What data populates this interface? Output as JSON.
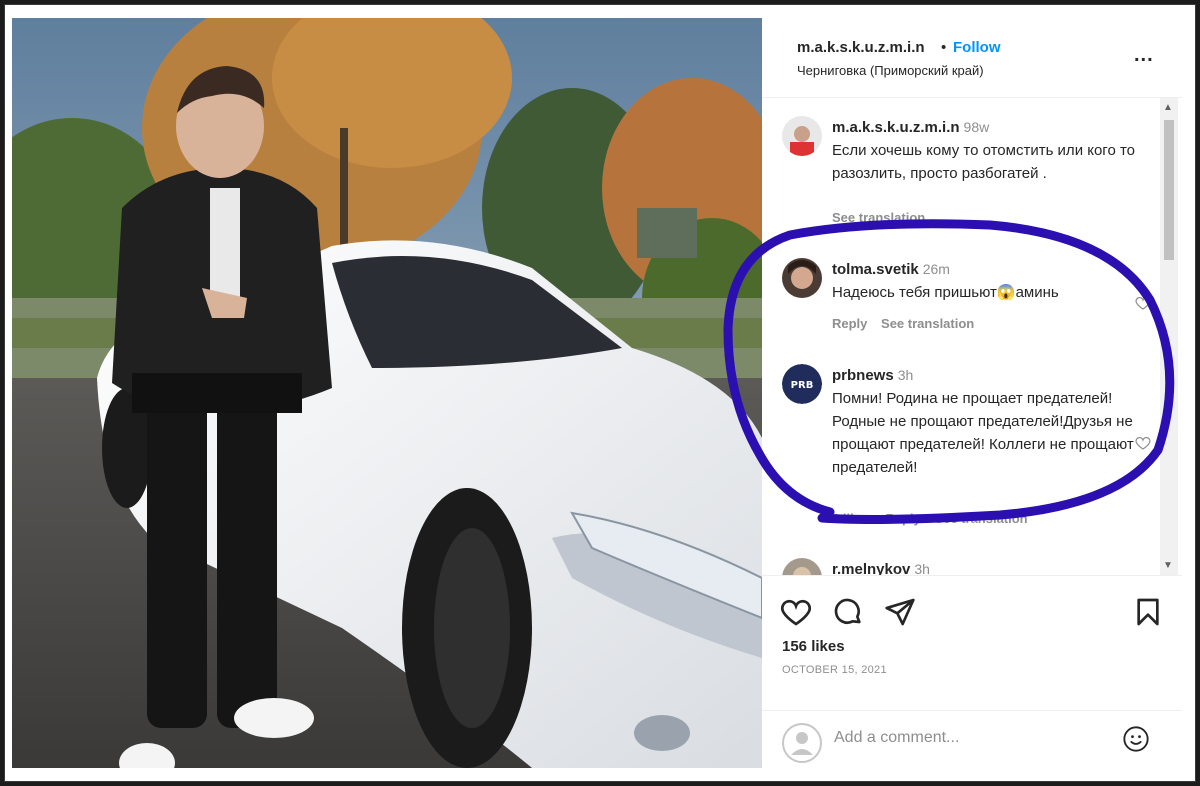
{
  "header": {
    "username": "m.a.k.s.k.u.z.m.i.n",
    "separator": "•",
    "follow_label": "Follow",
    "location": "Черниговка (Приморский край)",
    "more": "..."
  },
  "comments": [
    {
      "user": "m.a.k.s.k.u.z.m.i.n",
      "time": "98w",
      "text": "Если хочешь кому то отомстить или кого то разозлить, просто разбогатей .",
      "links": [
        "See translation"
      ]
    },
    {
      "user": "tolma.svetik",
      "time": "26m",
      "text": "Надеюсь тебя пришьют😱аминь",
      "links": [
        "Reply",
        "See translation"
      ]
    },
    {
      "user": "prbnews",
      "time": "3h",
      "text": "Помни! Родина не прощает предателей! Родные не прощают предателей!Друзья не прощают предателей! Коллеги не прощают предателей!",
      "links": [
        "3 likes",
        "Reply",
        "See translation"
      ]
    },
    {
      "user": "r.melnykov",
      "time": "3h",
      "text": "",
      "links": []
    }
  ],
  "avatars": {
    "prbnews_badge": "PRB"
  },
  "post": {
    "likes": "156 likes",
    "date": "OCTOBER 15, 2021"
  },
  "add_comment": {
    "placeholder": "Add a comment..."
  },
  "colors": {
    "follow": "#0095f6",
    "annotation": "#2b0fb0",
    "text": "#262626",
    "muted": "#8e8e8e"
  }
}
